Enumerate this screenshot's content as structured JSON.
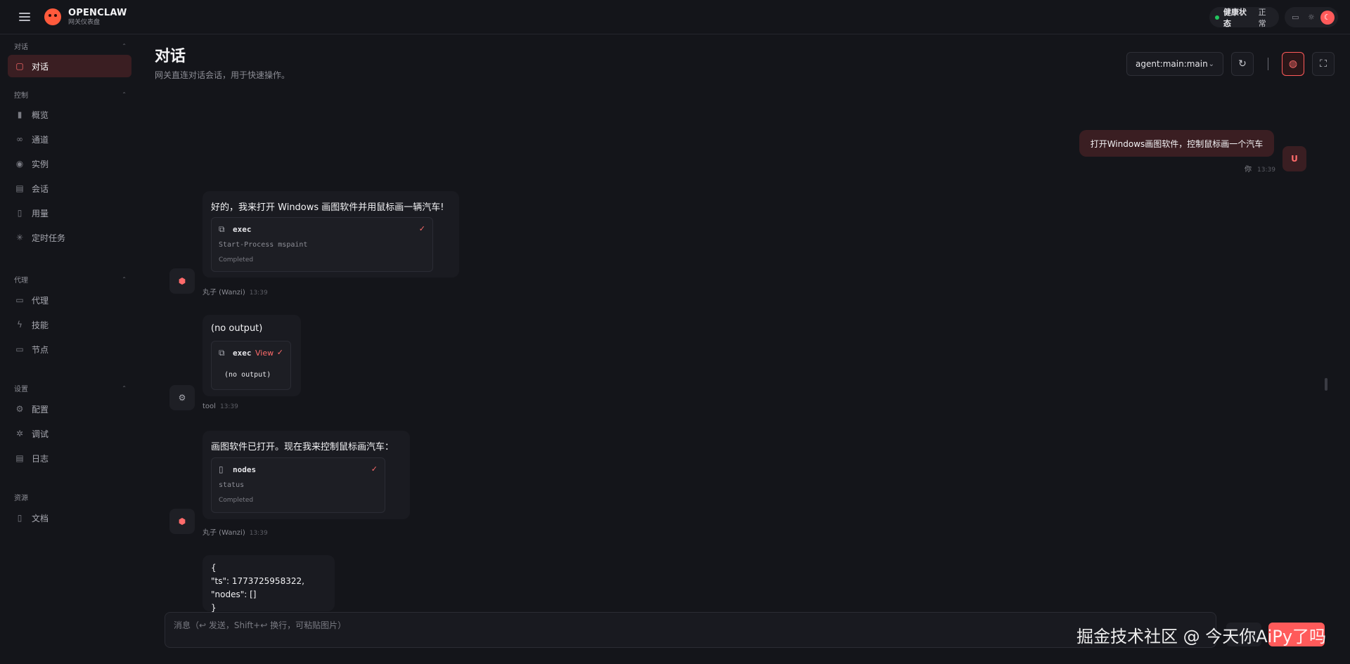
{
  "app": {
    "brand_title": "OPENCLAW",
    "brand_subtitle": "网关仪表盘"
  },
  "topbar": {
    "health_label": "健康状态",
    "health_value": "正常",
    "health_color": "#22c55e",
    "accent": "#ff5a5a"
  },
  "sidebar": {
    "sections": [
      {
        "label": "对话",
        "items": [
          {
            "label": "对话",
            "icon": "chat-icon",
            "active": true
          }
        ]
      },
      {
        "label": "控制",
        "items": [
          {
            "label": "概览",
            "icon": "bar-chart-icon"
          },
          {
            "label": "通道",
            "icon": "link-icon"
          },
          {
            "label": "实例",
            "icon": "broadcast-icon"
          },
          {
            "label": "会话",
            "icon": "document-icon"
          },
          {
            "label": "用量",
            "icon": "usage-chart-icon"
          },
          {
            "label": "定时任务",
            "icon": "loader-icon"
          }
        ]
      },
      {
        "label": "代理",
        "items": [
          {
            "label": "代理",
            "icon": "folder-icon"
          },
          {
            "label": "技能",
            "icon": "bolt-icon"
          },
          {
            "label": "节点",
            "icon": "monitor-icon"
          }
        ]
      },
      {
        "label": "设置",
        "items": [
          {
            "label": "配置",
            "icon": "gear-icon"
          },
          {
            "label": "调试",
            "icon": "bug-icon"
          },
          {
            "label": "日志",
            "icon": "file-text-icon"
          }
        ]
      },
      {
        "label": "资源",
        "items": [
          {
            "label": "文档",
            "icon": "book-icon"
          }
        ]
      }
    ]
  },
  "header": {
    "title": "对话",
    "subtitle": "网关直连对话会话，用于快速操作。",
    "agent_select": "agent:main:main"
  },
  "messages": {
    "user": {
      "text": "打开Windows画图软件，控制鼠标画一个汽车",
      "sender": "你",
      "time": "13:39",
      "avatar": "U"
    },
    "m1": {
      "text": "好的，我来打开 Windows 画图软件并用鼠标画一辆汽车!",
      "tool_name": "exec",
      "tool_cmd": "Start-Process mspaint",
      "tool_status": "Completed",
      "sender": "丸子 (Wanzi)",
      "time": "13:39"
    },
    "m2": {
      "text": "(no output)",
      "tool_name": "exec",
      "view_label": "View",
      "output": "(no output)",
      "sender": "tool",
      "time": "13:39"
    },
    "m3": {
      "text": "画图软件已打开。现在我来控制鼠标画汽车：",
      "tool_name": "nodes",
      "tool_cmd": "status",
      "tool_status": "Completed",
      "sender": "丸子 (Wanzi)",
      "time": "13:39"
    },
    "m4": {
      "lines": [
        "{",
        "\"ts\": 1773725958322,",
        "\"nodes\": []",
        "}"
      ]
    }
  },
  "composer": {
    "placeholder": "消息（↩ 发送，Shift+↩ 换行，可粘贴图片）"
  },
  "watermark": "掘金技术社区 @ 今天你AiPy了吗"
}
